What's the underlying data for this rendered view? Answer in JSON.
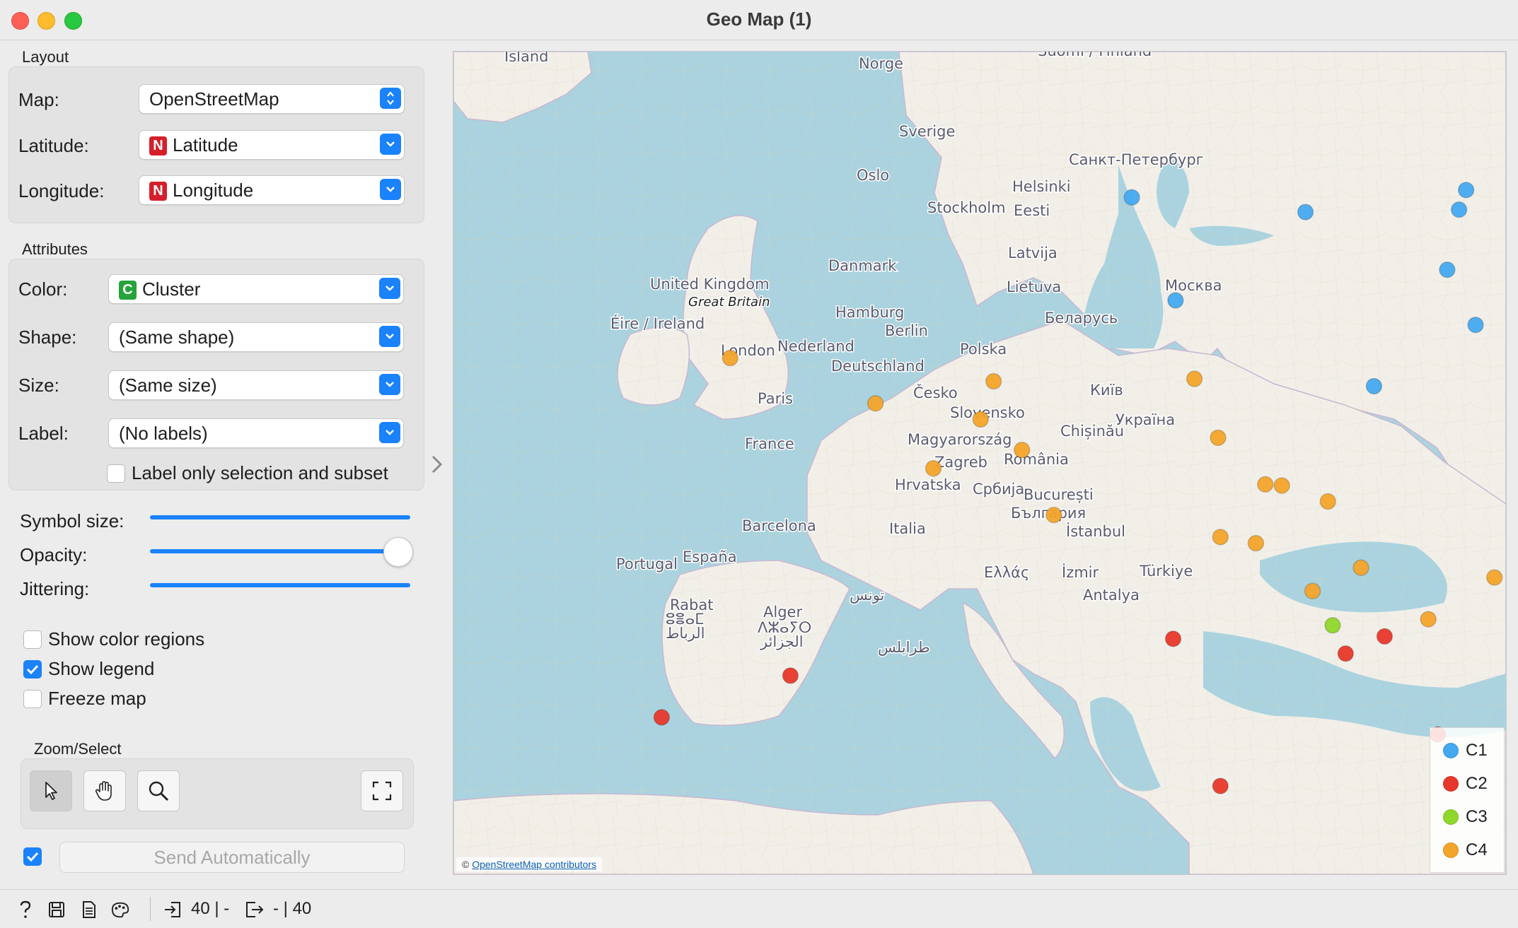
{
  "window": {
    "title": "Geo Map (1)"
  },
  "layout": {
    "section": "Layout",
    "map_label": "Map:",
    "map_value": "OpenStreetMap",
    "lat_label": "Latitude:",
    "lat_badge": "N",
    "lat_value": "Latitude",
    "lon_label": "Longitude:",
    "lon_badge": "N",
    "lon_value": "Longitude"
  },
  "attributes": {
    "section": "Attributes",
    "color_label": "Color:",
    "color_badge": "C",
    "color_value": "Cluster",
    "shape_label": "Shape:",
    "shape_value": "(Same shape)",
    "size_label": "Size:",
    "size_value": "(Same size)",
    "label_label": "Label:",
    "label_value": "(No labels)",
    "label_only": {
      "text": "Label only selection and subset",
      "checked": false
    }
  },
  "sliders": {
    "symbol_size": {
      "label": "Symbol size:"
    },
    "opacity": {
      "label": "Opacity:",
      "value": 0.95
    },
    "jittering": {
      "label": "Jittering:"
    }
  },
  "options": {
    "show_color_regions": {
      "label": "Show color regions",
      "checked": false
    },
    "show_legend": {
      "label": "Show legend",
      "checked": true
    },
    "freeze_map": {
      "label": "Freeze map",
      "checked": false
    }
  },
  "zoom_select": {
    "section": "Zoom/Select",
    "tools": [
      "pointer-icon",
      "hand-pan-icon",
      "magnifier-icon",
      "fit-to-extent-icon"
    ]
  },
  "send": {
    "label": "Send Automatically",
    "checked": true
  },
  "map": {
    "attribution_prefix": "©",
    "attribution_link": "OpenStreetMap contributors",
    "place_labels": [
      "Island",
      "Norge",
      "Suomi / Finland",
      "Sverige",
      "Oslo",
      "Санкт-Петербург",
      "Helsinki",
      "Stockholm",
      "Eesti",
      "Latvija",
      "Danmark",
      "United Kingdom",
      "Great Britain",
      "Lietuva",
      "Москва",
      "Éire / Ireland",
      "Hamburg",
      "Беларусь",
      "Berlin",
      "Nederland",
      "London",
      "Polska",
      "Deutschland",
      "Київ",
      "Česko",
      "Paris",
      "Slovensko",
      "Україна",
      "Chișinău",
      "Magyarország",
      "France",
      "Zagreb",
      "România",
      "Hrvatska",
      "Србија",
      "București",
      "България",
      "Barcelona",
      "Italia",
      "İstanbul",
      "España",
      "Portugal",
      "Ελλάς",
      "İzmir",
      "Türkiye",
      "Antalya",
      "Rabat",
      "ⵓⴻⴰⵎ",
      "الرباط",
      "Alger",
      "ⴷⵣⴰⵢⵔ",
      "الجزائر",
      "تونس",
      "طرابلس"
    ],
    "clusters": {
      "C1": "#45a9f0",
      "C2": "#e8382b",
      "C3": "#8fd72c",
      "C4": "#f3a42b"
    },
    "points": [
      {
        "c": "C1",
        "lon": -21.9,
        "lat": 64.1
      },
      {
        "c": "C1",
        "lon": 10.75,
        "lat": 59.9
      },
      {
        "c": "C1",
        "lon": 18.1,
        "lat": 59.3
      },
      {
        "c": "C1",
        "lon": 24.9,
        "lat": 60.2
      },
      {
        "c": "C1",
        "lon": 24.6,
        "lat": 59.4
      },
      {
        "c": "C1",
        "lon": 24.1,
        "lat": 56.95
      },
      {
        "c": "C1",
        "lon": 12.6,
        "lat": 55.7
      },
      {
        "c": "C1",
        "lon": 37.6,
        "lat": 55.75
      },
      {
        "c": "C1",
        "lon": 25.3,
        "lat": 54.7
      },
      {
        "c": "C1",
        "lon": 27.6,
        "lat": 53.9
      },
      {
        "c": "C1",
        "lon": 21.0,
        "lat": 52.2
      },
      {
        "c": "C1",
        "lon": 30.5,
        "lat": 50.45
      },
      {
        "c": "C4",
        "lon": -6.25,
        "lat": 53.35
      },
      {
        "c": "C4",
        "lon": -0.1,
        "lat": 51.5
      },
      {
        "c": "C4",
        "lon": 4.9,
        "lat": 52.4
      },
      {
        "c": "C4",
        "lon": 13.4,
        "lat": 52.5
      },
      {
        "c": "C4",
        "lon": 4.35,
        "lat": 50.85
      },
      {
        "c": "C4",
        "lon": 14.4,
        "lat": 50.1
      },
      {
        "c": "C4",
        "lon": 2.35,
        "lat": 48.85
      },
      {
        "c": "C4",
        "lon": 6.1,
        "lat": 49.6
      },
      {
        "c": "C4",
        "lon": 16.4,
        "lat": 48.2
      },
      {
        "c": "C4",
        "lon": 17.1,
        "lat": 48.15
      },
      {
        "c": "C4",
        "lon": 7.45,
        "lat": 46.95
      },
      {
        "c": "C4",
        "lon": 19.05,
        "lat": 47.5
      },
      {
        "c": "C4",
        "lon": 28.85,
        "lat": 47.0
      },
      {
        "c": "C4",
        "lon": 14.5,
        "lat": 46.05
      },
      {
        "c": "C4",
        "lon": 16.0,
        "lat": 45.8
      },
      {
        "c": "C4",
        "lon": 20.45,
        "lat": 44.8
      },
      {
        "c": "C4",
        "lon": 26.1,
        "lat": 44.4
      },
      {
        "c": "C4",
        "lon": 18.4,
        "lat": 43.85
      },
      {
        "c": "C4",
        "lon": 23.3,
        "lat": 42.7
      },
      {
        "c": "C3",
        "lon": 19.25,
        "lat": 42.45
      },
      {
        "c": "C2",
        "lon": 21.45,
        "lat": 42.0
      },
      {
        "c": "C2",
        "lon": 19.8,
        "lat": 41.3
      },
      {
        "c": "C2",
        "lon": 12.5,
        "lat": 41.9
      },
      {
        "c": "C2",
        "lon": -3.7,
        "lat": 40.4
      },
      {
        "c": "C2",
        "lon": -9.15,
        "lat": 38.7
      },
      {
        "c": "C2",
        "lon": 23.7,
        "lat": 38.0
      },
      {
        "c": "C2",
        "lon": 14.5,
        "lat": 35.9
      },
      {
        "c": "C2",
        "lon": 33.4,
        "lat": 35.15
      }
    ]
  },
  "legend": {
    "items": [
      {
        "label": "C1",
        "color": "#45a9f0"
      },
      {
        "label": "C2",
        "color": "#e8382b"
      },
      {
        "label": "C3",
        "color": "#8fd72c"
      },
      {
        "label": "C4",
        "color": "#f3a42b"
      }
    ]
  },
  "status": {
    "inputs": "40 | -",
    "outputs": "- | 40"
  }
}
